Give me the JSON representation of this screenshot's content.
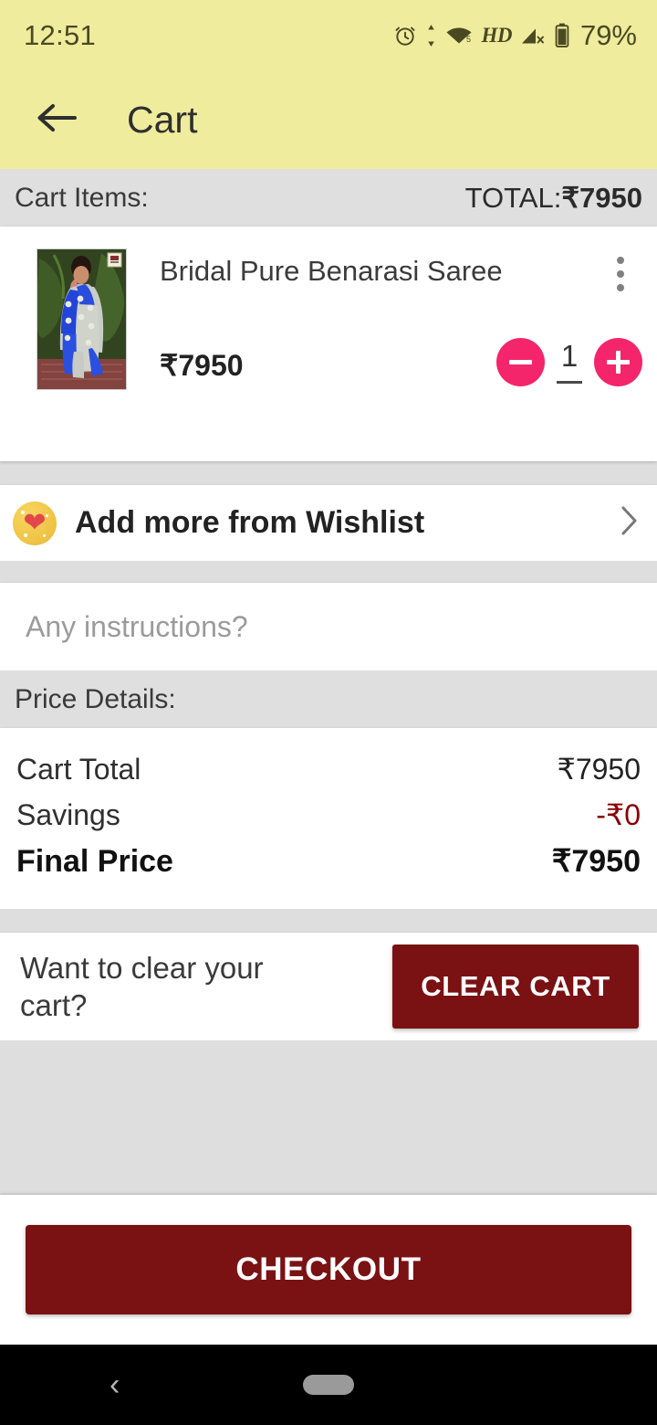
{
  "status_bar": {
    "time": "12:51",
    "battery_percent": "79%",
    "network_label": "HD",
    "wifi_level": "5",
    "icons": [
      "alarm-icon",
      "data-transfer-icon",
      "wifi-icon",
      "hd-icon",
      "signal-off-icon",
      "battery-icon"
    ]
  },
  "app_bar": {
    "title": "Cart",
    "back_label": "Back",
    "background_color": "#F0EC9E"
  },
  "cart_header": {
    "label": "Cart Items:",
    "total_prefix": "TOTAL:",
    "total_value": "₹7950"
  },
  "product": {
    "title": "Bridal Pure Benarasi Saree",
    "price": "₹7950",
    "quantity": "1",
    "decrease_label": "−",
    "increase_label": "+",
    "menu_label": "More options"
  },
  "wishlist": {
    "label": "Add more from Wishlist",
    "icon": "sparkling-heart-icon",
    "chevron": "›"
  },
  "instructions": {
    "placeholder": "Any instructions?",
    "value": ""
  },
  "price_details": {
    "heading": "Price Details:",
    "rows": [
      {
        "label": "Cart Total",
        "value": "₹7950"
      },
      {
        "label": "Savings",
        "value": "-₹0"
      },
      {
        "label": "Final Price",
        "value": "₹7950"
      }
    ]
  },
  "clear_cart": {
    "question": "Want to clear your cart?",
    "button_label": "CLEAR CART"
  },
  "footer": {
    "checkout_label": "CHECKOUT"
  },
  "nav_bar": {
    "back_glyph": "‹",
    "home_pill": "home-indicator"
  },
  "colors": {
    "app_bar": "#F0EC9E",
    "accent_pink": "#F4256B",
    "maroon": "#7A1113",
    "savings_red": "#8B0000",
    "page_bg": "#DEDEDE"
  }
}
